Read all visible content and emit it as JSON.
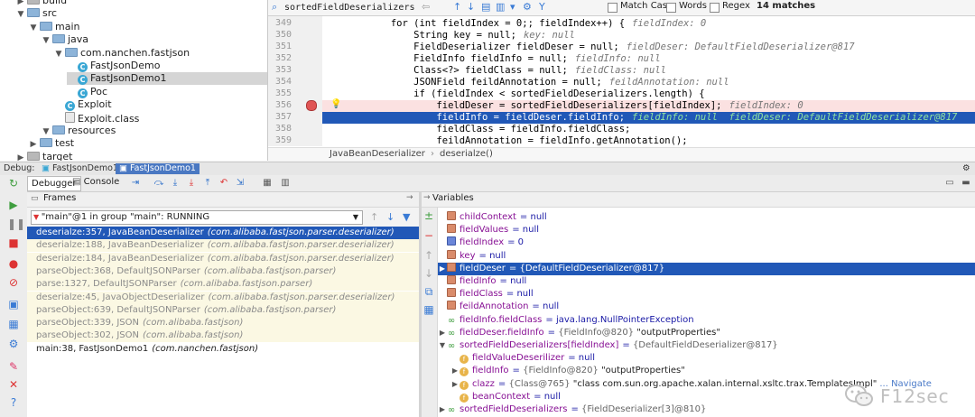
{
  "project_tree": {
    "items": [
      {
        "label": "build",
        "indent": 1,
        "kind": "folder"
      },
      {
        "label": "src",
        "indent": 1,
        "kind": "folder"
      },
      {
        "label": "main",
        "indent": 2,
        "kind": "folder"
      },
      {
        "label": "java",
        "indent": 3,
        "kind": "folder"
      },
      {
        "label": "com.nanchen.fastjson",
        "indent": 4,
        "kind": "folder"
      },
      {
        "label": "FastJsonDemo",
        "indent": 5,
        "kind": "class"
      },
      {
        "label": "FastJsonDemo1",
        "indent": 5,
        "kind": "class"
      },
      {
        "label": "Poc",
        "indent": 5,
        "kind": "class"
      },
      {
        "label": "Exploit",
        "indent": 4,
        "kind": "class"
      },
      {
        "label": "Exploit.class",
        "indent": 4,
        "kind": "file"
      },
      {
        "label": "resources",
        "indent": 3,
        "kind": "folder"
      },
      {
        "label": "test",
        "indent": 2,
        "kind": "folder"
      },
      {
        "label": "target",
        "indent": 1,
        "kind": "folder"
      }
    ]
  },
  "search": {
    "query": "sortedFieldDeserializers",
    "match_case": "Match Case",
    "words": "Words",
    "regex": "Regex",
    "matches": "14 matches"
  },
  "editor": {
    "lines": [
      {
        "num": "349",
        "code": "            for (int fieldIndex = 0;; fieldIndex++) {",
        "hint": "fieldIndex: 0"
      },
      {
        "num": "350",
        "code": "                String key = null;",
        "hint": "key: null"
      },
      {
        "num": "351",
        "code": "                FieldDeserializer fieldDeser = null;",
        "hint": "fieldDeser: DefaultFieldDeserializer@817"
      },
      {
        "num": "352",
        "code": "                FieldInfo fieldInfo = null;",
        "hint": "fieldInfo: null"
      },
      {
        "num": "353",
        "code": "                Class<?> fieldClass = null;",
        "hint": "fieldClass: null"
      },
      {
        "num": "354",
        "code": "                JSONField feildAnnotation = null;",
        "hint": "feildAnnotation: null"
      },
      {
        "num": "355",
        "code": "                if (fieldIndex < sortedFieldDeserializers.length) {",
        "hint": ""
      },
      {
        "num": "356",
        "code": "                    fieldDeser = sortedFieldDeserializers[fieldIndex];",
        "hint": "fieldIndex: 0"
      },
      {
        "num": "357",
        "code": "                    fieldInfo = fieldDeser.fieldInfo;",
        "hint": "fieldInfo: null  fieldDeser: DefaultFieldDeserializer@817"
      },
      {
        "num": "358",
        "code": "                    fieldClass = fieldInfo.fieldClass;",
        "hint": ""
      },
      {
        "num": "359",
        "code": "                    feildAnnotation = fieldInfo.getAnnotation();",
        "hint": ""
      }
    ],
    "breadcrumb_class": "JavaBeanDeserializer",
    "breadcrumb_method": "deserialze()"
  },
  "debug": {
    "label": "Debug:",
    "tabs": [
      "FastJsonDemo1",
      "FastJsonDemo1"
    ],
    "debugger_tab": "Debugger",
    "console_tab": "Console"
  },
  "frames": {
    "title": "Frames",
    "thread": "\"main\"@1 in group \"main\": RUNNING",
    "items": [
      {
        "method": "deserialze:357, JavaBeanDeserializer",
        "pkg": "(com.alibaba.fastjson.parser.deserializer)",
        "state": "sel"
      },
      {
        "method": "deserialze:188, JavaBeanDeserializer",
        "pkg": "(com.alibaba.fastjson.parser.deserializer)",
        "state": "lib"
      },
      {
        "method": "deserialze:184, JavaBeanDeserializer",
        "pkg": "(com.alibaba.fastjson.parser.deserializer)",
        "state": "lib"
      },
      {
        "method": "parseObject:368, DefaultJSONParser",
        "pkg": "(com.alibaba.fastjson.parser)",
        "state": "lib"
      },
      {
        "method": "parse:1327, DefaultJSONParser",
        "pkg": "(com.alibaba.fastjson.parser)",
        "state": "lib"
      },
      {
        "method": "deserialze:45, JavaObjectDeserializer",
        "pkg": "(com.alibaba.fastjson.parser.deserializer)",
        "state": "lib"
      },
      {
        "method": "parseObject:639, DefaultJSONParser",
        "pkg": "(com.alibaba.fastjson.parser)",
        "state": "lib"
      },
      {
        "method": "parseObject:339, JSON",
        "pkg": "(com.alibaba.fastjson)",
        "state": "lib"
      },
      {
        "method": "parseObject:302, JSON",
        "pkg": "(com.alibaba.fastjson)",
        "state": "lib"
      },
      {
        "method": "main:38, FastJsonDemo1",
        "pkg": "(com.nanchen.fastjson)",
        "state": "normal"
      }
    ]
  },
  "variables": {
    "title": "Variables",
    "items": [
      {
        "name": "childContext",
        "value": "= null",
        "ref": "",
        "extra": "",
        "icon": "field",
        "arrow": "",
        "indent": 0
      },
      {
        "name": "fieldValues",
        "value": "= null",
        "ref": "",
        "extra": "",
        "icon": "field",
        "arrow": "",
        "indent": 0
      },
      {
        "name": "fieldIndex",
        "value": "= 0",
        "ref": "",
        "extra": "",
        "icon": "fieldi",
        "arrow": "",
        "indent": 0
      },
      {
        "name": "key",
        "value": "= null",
        "ref": "",
        "extra": "",
        "icon": "field",
        "arrow": "",
        "indent": 0
      },
      {
        "name": "fieldDeser",
        "value": "= {DefaultFieldDeserializer@817}",
        "ref": "",
        "extra": "",
        "icon": "field",
        "arrow": "▶",
        "indent": 0,
        "sel": true
      },
      {
        "name": "fieldInfo",
        "value": "= null",
        "ref": "",
        "extra": "",
        "icon": "field",
        "arrow": "",
        "indent": 0
      },
      {
        "name": "fieldClass",
        "value": "= null",
        "ref": "",
        "extra": "",
        "icon": "field",
        "arrow": "",
        "indent": 0
      },
      {
        "name": "feildAnnotation",
        "value": "= null",
        "ref": "",
        "extra": "",
        "icon": "field",
        "arrow": "",
        "indent": 0
      },
      {
        "name": "fieldInfo.fieldClass",
        "value": "= java.lang.NullPointerException",
        "ref": "",
        "extra": "",
        "icon": "watch",
        "arrow": "",
        "indent": 0
      },
      {
        "name": "fieldDeser.fieldInfo",
        "value": "= ",
        "ref": "{FieldInfo@820}",
        "extra": " \"outputProperties\"",
        "icon": "watch",
        "arrow": "▶",
        "indent": 0
      },
      {
        "name": "sortedFieldDeserializers[fieldIndex]",
        "value": "= ",
        "ref": "{DefaultFieldDeserializer@817}",
        "extra": "",
        "icon": "watch",
        "arrow": "▼",
        "indent": 0
      },
      {
        "name": "fieldValueDeserilizer",
        "value": "= null",
        "ref": "",
        "extra": "",
        "icon": "f",
        "arrow": "",
        "indent": 1
      },
      {
        "name": "fieldInfo",
        "value": "= ",
        "ref": "{FieldInfo@820}",
        "extra": " \"outputProperties\"",
        "icon": "f",
        "arrow": "▶",
        "indent": 1
      },
      {
        "name": "clazz",
        "value": "= ",
        "ref": "{Class@765}",
        "extra": " \"class com.sun.org.apache.xalan.internal.xsltc.trax.TemplatesImpl\"",
        "nav": "... Navigate",
        "icon": "f",
        "arrow": "▶",
        "indent": 1
      },
      {
        "name": "beanContext",
        "value": "= null",
        "ref": "",
        "extra": "",
        "icon": "f",
        "arrow": "",
        "indent": 1
      },
      {
        "name": "sortedFieldDeserializers",
        "value": "= ",
        "ref": "{FieldDeserializer[3]@810}",
        "extra": "",
        "icon": "watch",
        "arrow": "▶",
        "indent": 0
      }
    ]
  },
  "watermark": {
    "text": "F12sec"
  },
  "colors": {
    "selection": "#2158b7",
    "highlight": "#ffff00",
    "breakpoint": "#e05555"
  }
}
